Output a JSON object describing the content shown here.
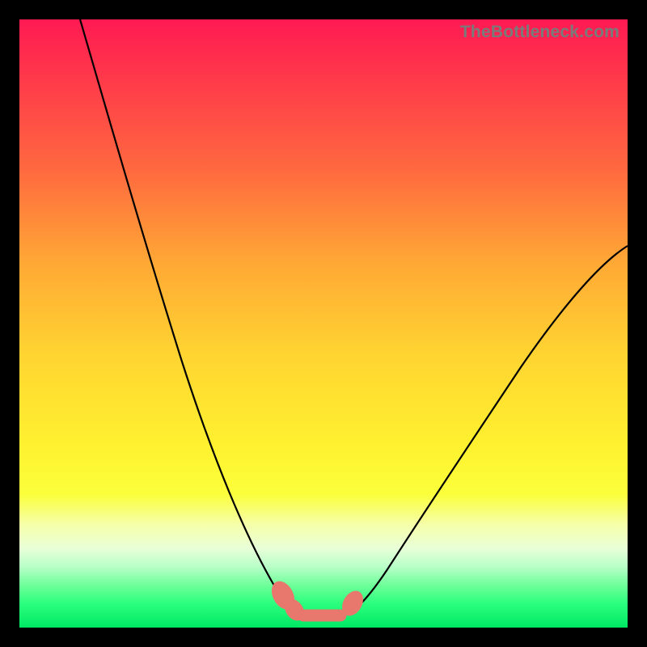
{
  "watermark": "TheBottleneck.com",
  "colors": {
    "frame": "#000000",
    "gradient_top": "#ff1a52",
    "gradient_mid": "#fff12f",
    "gradient_bottom": "#00e865",
    "curve_stroke": "#000000",
    "blob_fill": "#e8776e"
  },
  "chart_data": {
    "type": "line",
    "title": "",
    "xlabel": "",
    "ylabel": "",
    "xlim": [
      0,
      100
    ],
    "ylim": [
      0,
      100
    ],
    "grid": false,
    "legend": false,
    "series": [
      {
        "name": "left-curve",
        "x": [
          10,
          15,
          20,
          25,
          30,
          35,
          40,
          43,
          45
        ],
        "values": [
          100,
          86,
          71,
          56,
          42,
          28,
          14,
          5,
          2
        ]
      },
      {
        "name": "right-curve",
        "x": [
          54,
          57,
          60,
          65,
          70,
          75,
          80,
          85,
          90,
          95,
          100
        ],
        "values": [
          2,
          4,
          6,
          12,
          20,
          28,
          36,
          44,
          52,
          58,
          62
        ]
      }
    ],
    "annotations": [
      {
        "name": "blob-left",
        "x": 43,
        "y": 4
      },
      {
        "name": "blob-mid",
        "x": 49,
        "y": 2
      },
      {
        "name": "blob-right",
        "x": 55,
        "y": 4
      }
    ],
    "notes": "y values are approximate percentages read from the vertical position of the black curves against the full plot height (0 = bottom, 100 = top). No axis ticks or numeric labels are present in the image."
  }
}
